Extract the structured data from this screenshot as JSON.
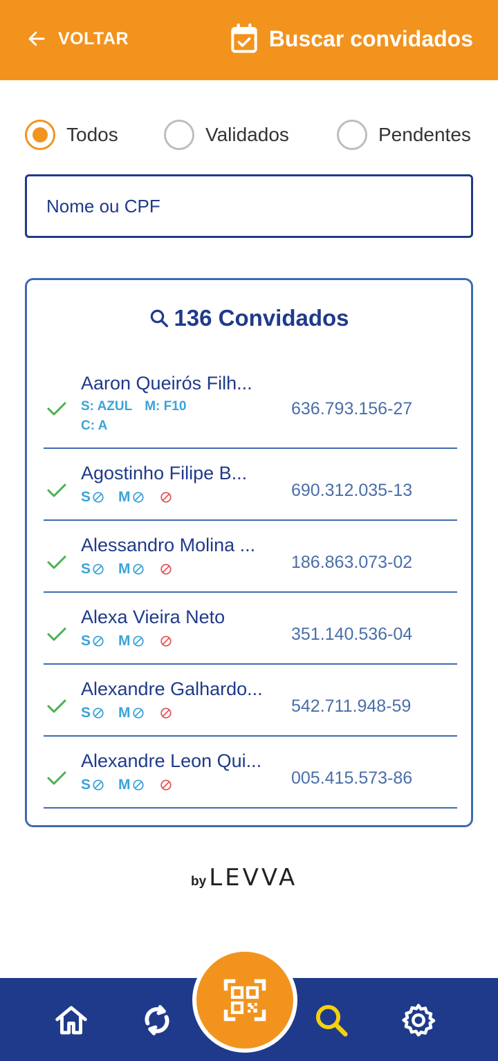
{
  "header": {
    "back_label": "VOLTAR",
    "title": "Buscar convidados"
  },
  "filters": {
    "options": [
      "Todos",
      "Validados",
      "Pendentes"
    ],
    "selected": "Todos"
  },
  "search": {
    "placeholder": "Nome ou CPF",
    "value": ""
  },
  "list": {
    "title": "136 Convidados",
    "guests": [
      {
        "name": "Aaron Queirós Filh...",
        "cpf": "636.793.156-27",
        "s": "S: AZUL",
        "m": "M: F10",
        "c": "C: A",
        "validated": true
      },
      {
        "name": "Agostinho Filipe B...",
        "cpf": "690.312.035-13",
        "s": "S",
        "m": "M",
        "validated": true
      },
      {
        "name": "Alessandro Molina ...",
        "cpf": "186.863.073-02",
        "s": "S",
        "m": "M",
        "validated": true
      },
      {
        "name": "Alexa Vieira Neto",
        "cpf": "351.140.536-04",
        "s": "S",
        "m": "M",
        "validated": true
      },
      {
        "name": "Alexandre Galhardo...",
        "cpf": "542.711.948-59",
        "s": "S",
        "m": "M",
        "validated": true
      },
      {
        "name": "Alexandre Leon Qui...",
        "cpf": "005.415.573-86",
        "s": "S",
        "m": "M",
        "validated": true
      }
    ]
  },
  "brand": {
    "by": "by",
    "name": "LEVVA"
  },
  "nav": {
    "items": [
      "home-icon",
      "sync-icon",
      "qr-code-icon",
      "search-icon",
      "settings-icon"
    ],
    "active": "search-icon"
  },
  "colors": {
    "accent": "#F2931E",
    "primary": "#1F3A8A",
    "tag": "#3BA3D9",
    "check": "#4CAF50",
    "block": "#E05555"
  }
}
